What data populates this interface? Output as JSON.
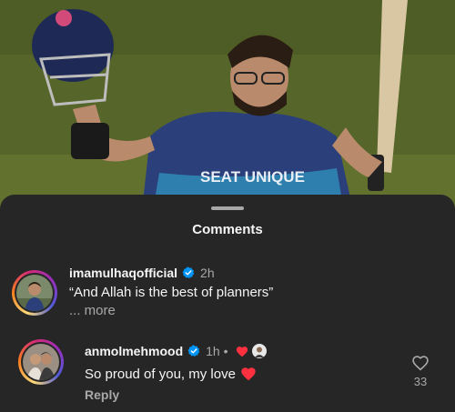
{
  "sheet": {
    "title": "Comments"
  },
  "photo": {
    "jersey_text": "SEAT UNIQUE"
  },
  "comments": [
    {
      "username": "imamulhaqofficial",
      "time": "2h",
      "text": "“And Allah is the best of planners”",
      "more": "... more",
      "verified": true
    },
    {
      "username": "anmolmehmood",
      "time": "1h •",
      "text": "So proud of you, my love",
      "reply": "Reply",
      "likes": "33",
      "verified": true
    }
  ],
  "colors": {
    "background": "#262626",
    "verified_blue": "#0095f6",
    "heart_red": "#ff3040",
    "muted_text": "#a8a8a8"
  }
}
